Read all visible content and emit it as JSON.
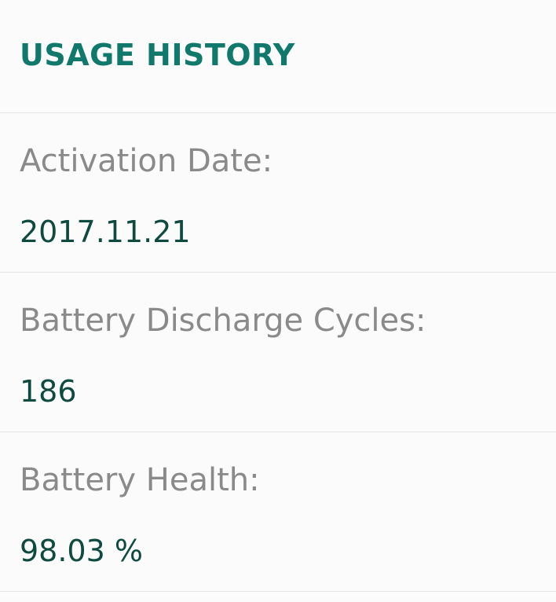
{
  "section": {
    "title": "USAGE HISTORY"
  },
  "rows": [
    {
      "label": "Activation Date:",
      "value": "2017.11.21"
    },
    {
      "label": "Battery Discharge Cycles:",
      "value": "186"
    },
    {
      "label": "Battery Health:",
      "value": "98.03 %"
    }
  ],
  "colors": {
    "title": "#11786c",
    "label": "#8a8a8a",
    "value": "#0f4a40",
    "background": "#fbfbfb",
    "divider": "#e6e6e6"
  }
}
